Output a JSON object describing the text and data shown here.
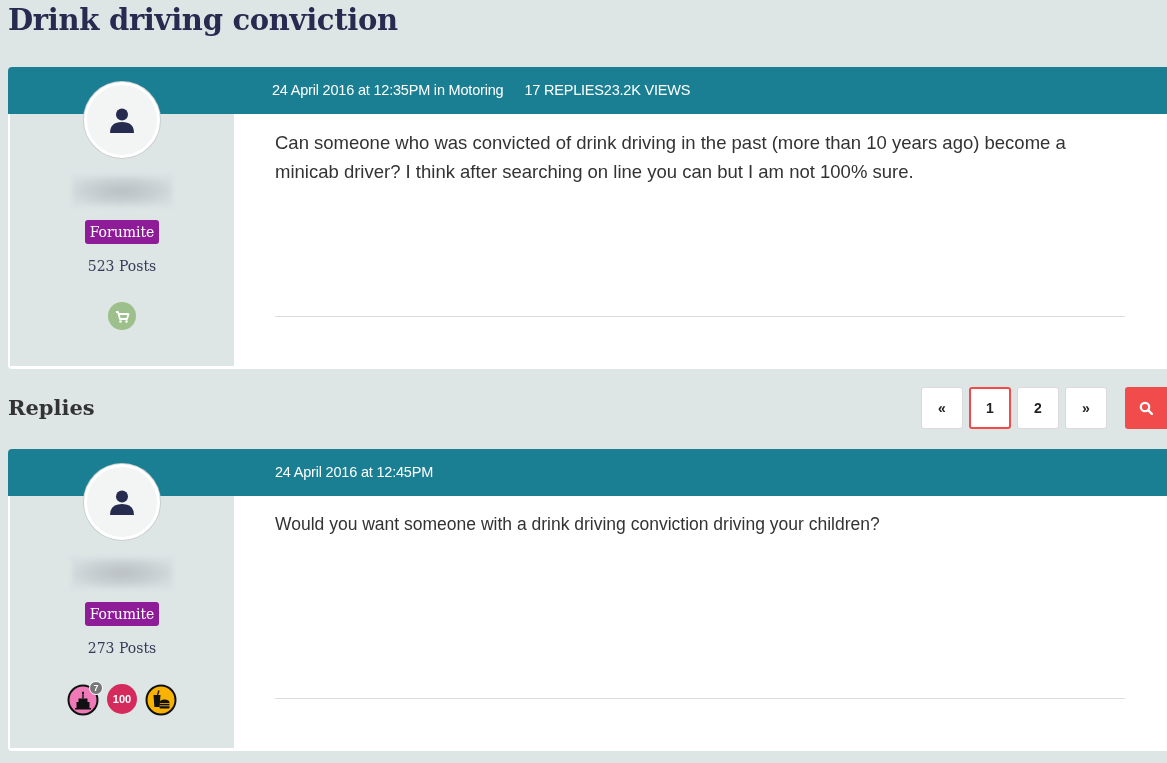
{
  "thread_title": "Drink driving conviction",
  "original_post": {
    "author": {
      "rank": "Forumite",
      "posts": "523 Posts",
      "badges": [
        {
          "kind": "cart",
          "color": "#9dbf8c"
        }
      ]
    },
    "meta": "24 April 2016 at 12:35PM in Motoring",
    "stats": "17 REPLIES23.2K VIEWS",
    "body": "Can someone who was convicted of drink driving in the past (more than 10 years ago) become a minicab driver? I think after searching on line you can but I am not 100% sure."
  },
  "replies_section": {
    "heading": "Replies",
    "pagination": [
      {
        "label": "«",
        "selected": false
      },
      {
        "label": "1",
        "selected": true
      },
      {
        "label": "2",
        "selected": false
      },
      {
        "label": "»",
        "selected": false
      }
    ]
  },
  "replies": [
    {
      "author": {
        "rank": "Forumite",
        "posts": "273 Posts",
        "badges": [
          {
            "kind": "cake",
            "color": "#f07ab8",
            "count": "7"
          },
          {
            "kind": "number",
            "color": "#d42a5c",
            "label": "100"
          },
          {
            "kind": "meal",
            "color": "#f9b200"
          }
        ]
      },
      "meta": "24 April 2016 at 12:45PM",
      "body": "Would you want someone with a drink driving conviction driving your children?"
    }
  ]
}
